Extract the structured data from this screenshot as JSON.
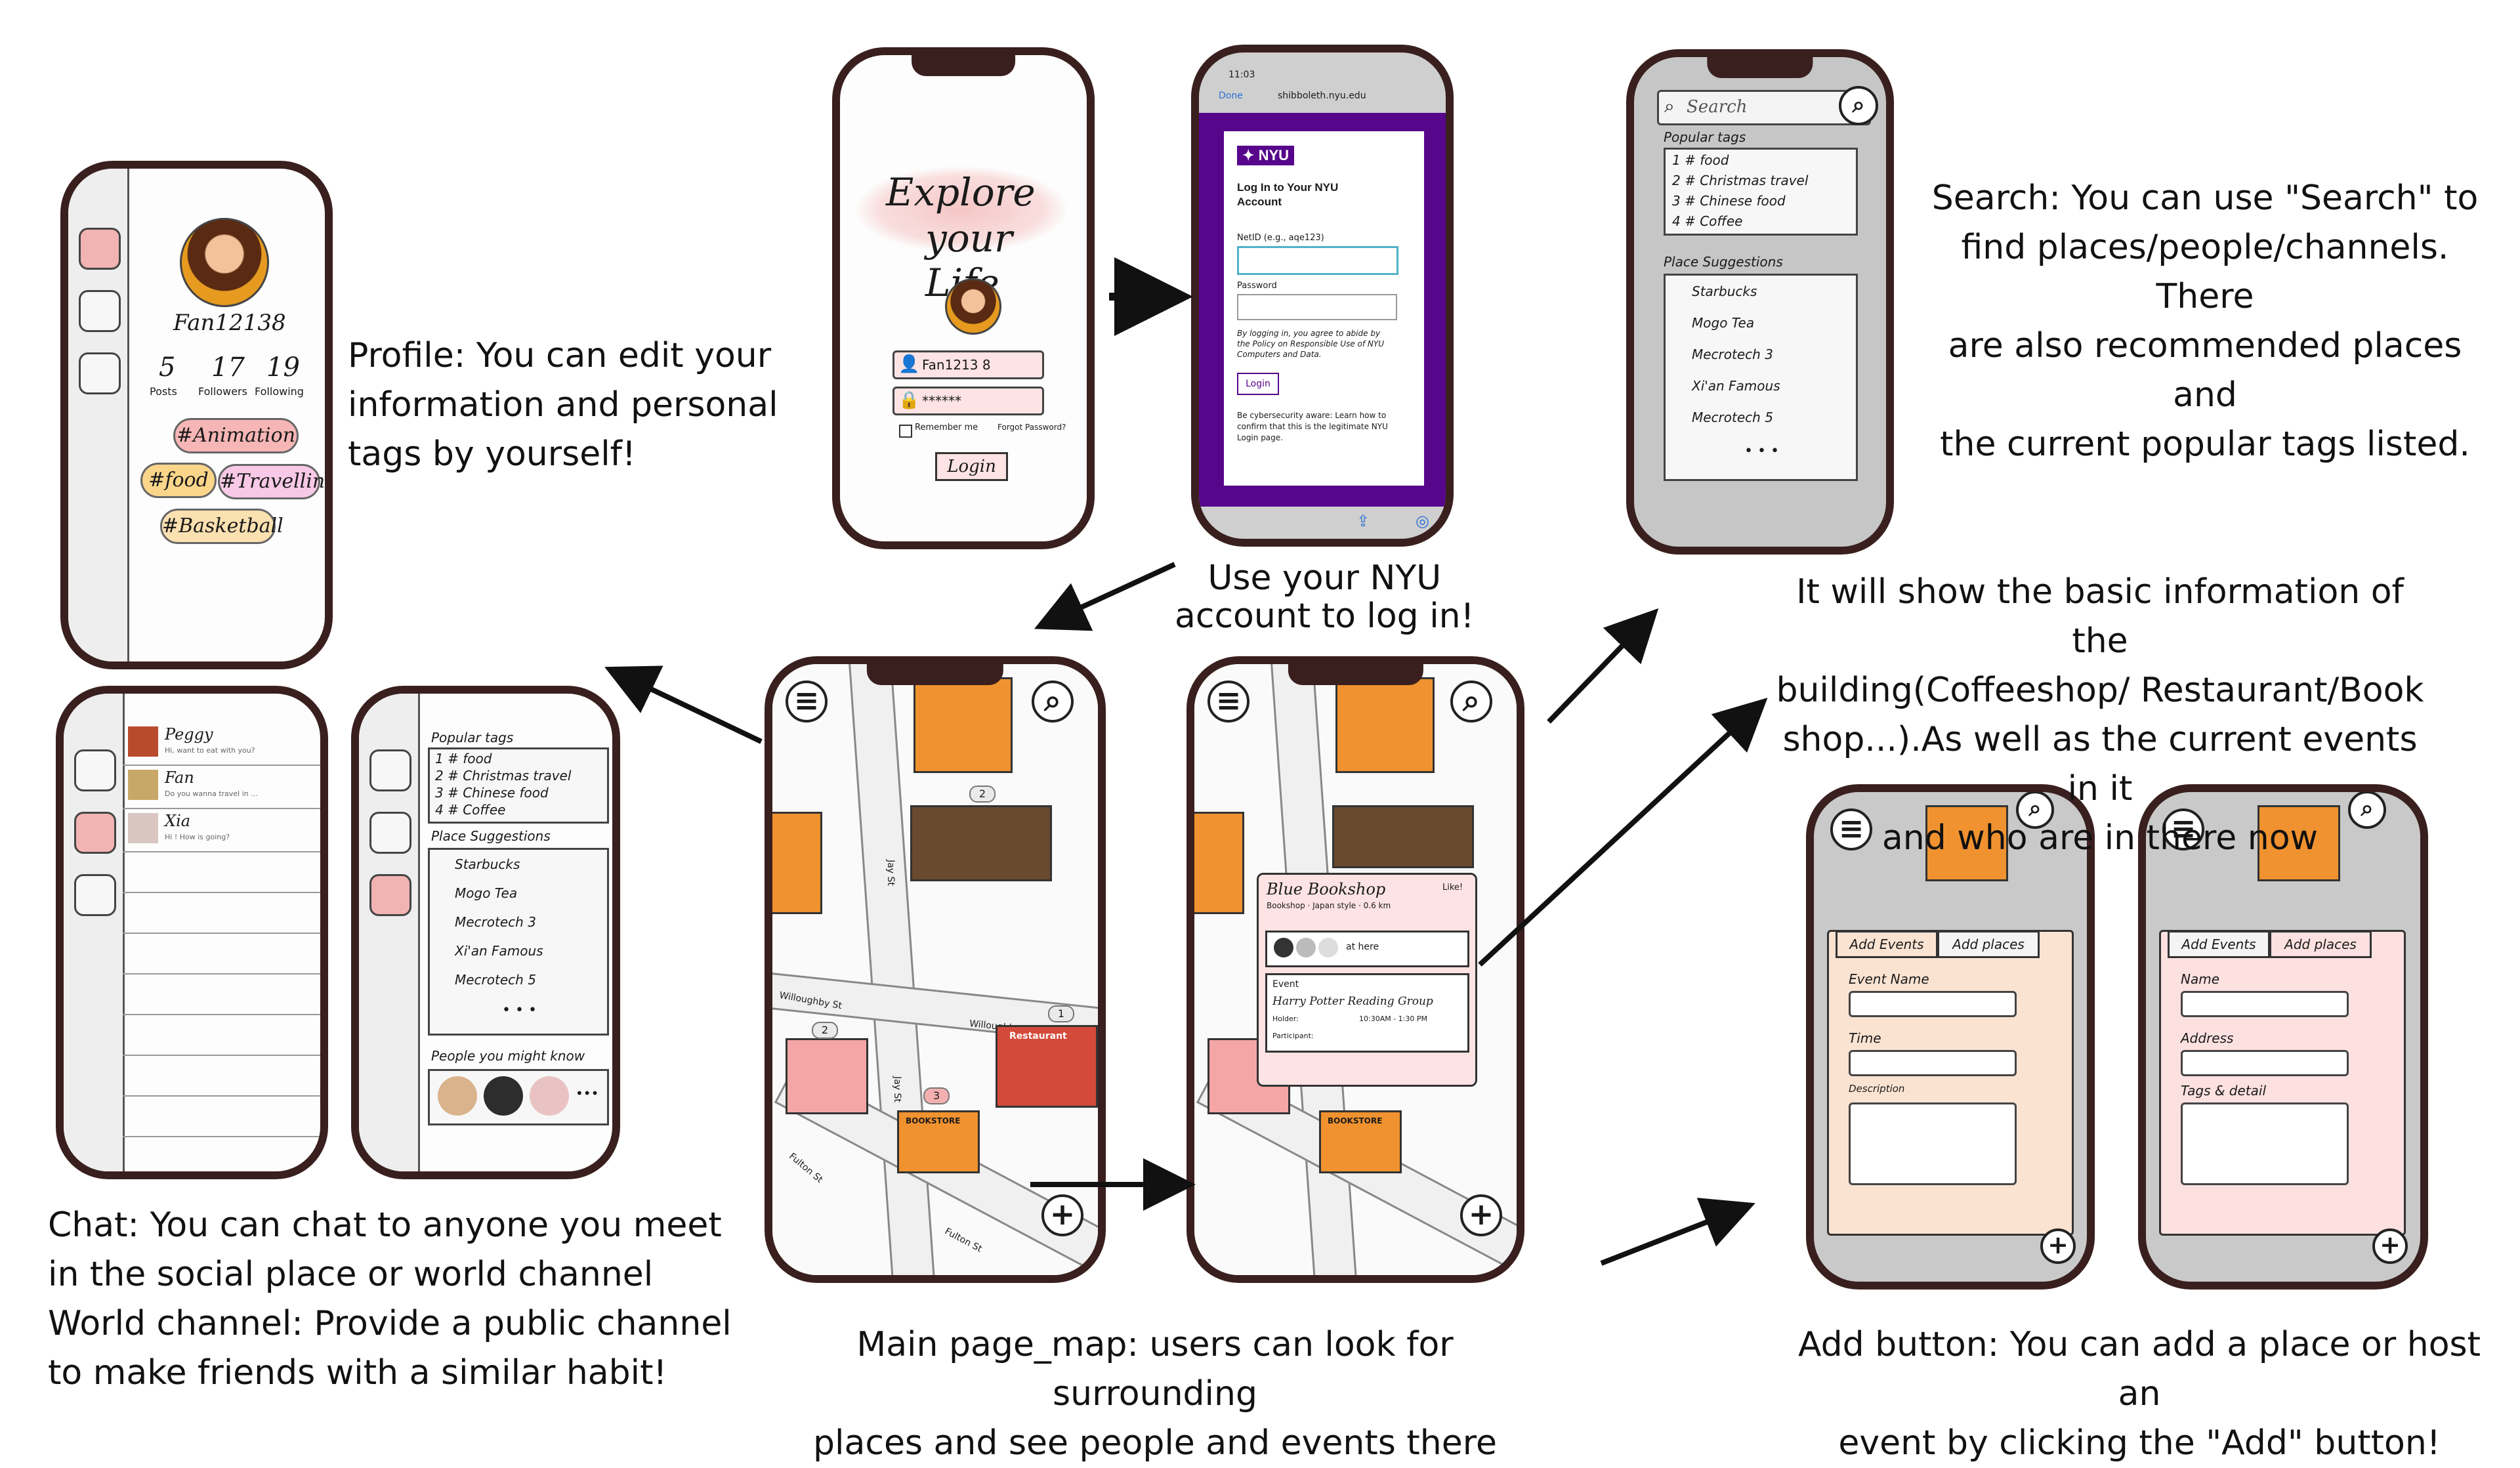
{
  "captions": {
    "profile": [
      "Profile: You can edit your",
      "information and personal",
      "tags by yourself!"
    ],
    "login": [
      "Use your NYU",
      "account to log in!"
    ],
    "search": [
      "Search: You can use \"Search\" to",
      "find places/people/channels. There",
      "are also recommended places and",
      "the current popular tags listed."
    ],
    "building_info": [
      "It will show the basic information of the",
      "building(Coffeeshop/ Restaurant/Book",
      "shop...).As well as the current events in it",
      "and who are in there now"
    ],
    "chat": [
      "Chat: You can chat to anyone you meet",
      "in the social place or world channel",
      "World channel: Provide a public channel",
      "to make friends with a similar habit!"
    ],
    "main": [
      "Main page_map: users can look for surrounding",
      "places and see people and events there"
    ],
    "add": [
      "Add button: You can add a place or host an",
      "event by clicking the \"Add\" button!"
    ]
  },
  "login_screen": {
    "headline_1": "Explore",
    "headline_2": "your Life",
    "username": "Fan1213 8",
    "password": "******",
    "remember": "Remember me",
    "forgot": "Forgot Password?",
    "button": "Login"
  },
  "nyu_screen": {
    "time": "11:03",
    "done": "Done",
    "url": "shibboleth.nyu.edu",
    "brand": "NYU",
    "title": "Log In to Your NYU Account",
    "netid_label": "NetID (e.g., aqe123)",
    "password_label": "Password",
    "policy_text": "By logging in, you agree to abide by the Policy on Responsible Use of NYU Computers and Data.",
    "login_button": "Login",
    "security_text": "Be cybersecurity aware: Learn how to confirm that this is the legitimate NYU Login page."
  },
  "profile_screen": {
    "username": "Fan12138",
    "stats": [
      {
        "value": "5",
        "label": "Posts"
      },
      {
        "value": "17",
        "label": "Followers"
      },
      {
        "value": "19",
        "label": "Following"
      }
    ],
    "tags": [
      "#Animation",
      "#food",
      "#Travelling",
      "#Basketball"
    ]
  },
  "search_screen": {
    "placeholder": "Search",
    "popular_title": "Popular tags",
    "tags": [
      "1 # food",
      "2 # Christmas travel",
      "3 # Chinese food",
      "4 # Coffee"
    ],
    "suggest_title": "Place Suggestions",
    "places": [
      "Starbucks",
      "Mogo Tea",
      "Mecrotech 3",
      "Xi'an Famous",
      "Mecrotech 5"
    ],
    "more": "• • •"
  },
  "chat_screen": {
    "chats": [
      {
        "name": "Peggy",
        "preview": "Hi, want to eat with you?"
      },
      {
        "name": "Fan",
        "preview": "Do you wanna travel in ..."
      },
      {
        "name": "Xia",
        "preview": "Hi ! How is going?"
      }
    ]
  },
  "world_screen": {
    "popular_title": "Popular tags",
    "tags": [
      "1 # food",
      "2 # Christmas travel",
      "3 # Chinese food",
      "4 # Coffee"
    ],
    "suggest_title": "Place Suggestions",
    "places": [
      "Starbucks",
      "Mogo Tea",
      "Mecrotech 3",
      "Xi'an Famous",
      "Mecrotech 5"
    ],
    "more": "• • •",
    "people_title": "People you might know"
  },
  "map": {
    "streets": [
      "Willoughby St",
      "Willoughby St",
      "Fulton St",
      "Fulton St",
      "Jay St",
      "Jay St"
    ],
    "bookstore": "BOOKSTORE",
    "restaurant": "Restaurant",
    "badges": [
      "2",
      "2",
      "1",
      "3"
    ]
  },
  "bookshop_popup": {
    "title": "Blue Bookshop",
    "subtitle": "Bookshop · Japan style · 0.6 km",
    "like": "Like!",
    "at_here": "at here",
    "event_label": "Event",
    "event_name": "Harry Potter Reading Group",
    "holder": "Holder:",
    "time": "10:30AM - 1:30 PM",
    "participant": "Participant:"
  },
  "add_event_screen": {
    "tab_events": "Add Events",
    "tab_places": "Add places",
    "field1": "Event Name",
    "field2": "Time",
    "field3": "Description"
  },
  "add_place_screen": {
    "tab_events": "Add Events",
    "tab_places": "Add places",
    "field1": "Name",
    "field2": "Address",
    "field3": "Tags & detail"
  },
  "colors": {
    "frame": "#3a1f1f",
    "nyu_purple": "#57068c",
    "pink": "#f2b3b3",
    "peach": "#fbe3d2",
    "building_orange": "#f0922f"
  }
}
